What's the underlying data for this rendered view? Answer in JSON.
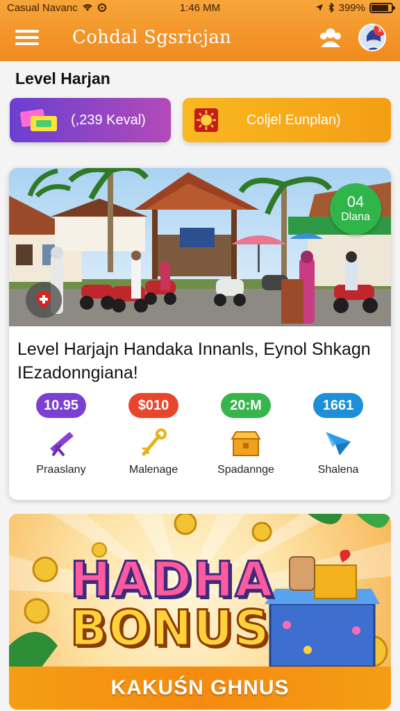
{
  "status_bar": {
    "carrier": "Casual Navanc",
    "time": "1:46 MM",
    "battery": "399%"
  },
  "header": {
    "title": "Cohdal Sgsricjan",
    "menu_icon": "hamburger-menu-icon",
    "group_icon": "users-icon",
    "notification_badge": "x"
  },
  "section": {
    "title": "Level Harjan"
  },
  "action_buttons": {
    "left": {
      "label": "(,239 Keval)",
      "icon": "tickets-icon",
      "color": "#7b3fd1"
    },
    "right": {
      "label": "Coljel Eunplan)",
      "icon": "sun-badge-icon",
      "color": "#f6a81a"
    }
  },
  "feature_card": {
    "badge_number": "04",
    "badge_text": "Dlana",
    "headline": "Level Harjajn Handaka Innanls, Eynol Shkagn IEzadonngiana!",
    "stats": [
      {
        "value": "10.95",
        "label": "Praaslany",
        "icon": "telescope-icon",
        "color": "#7b3fd1"
      },
      {
        "value": "$010",
        "label": "Malenage",
        "icon": "wrench-icon",
        "color": "#e8452c"
      },
      {
        "value": "20:M",
        "label": "Spadannge",
        "icon": "box-icon",
        "color": "#36b54a"
      },
      {
        "value": "1661",
        "label": "Shalena",
        "icon": "paper-plane-icon",
        "color": "#1c8fd8"
      }
    ]
  },
  "promo_banner": {
    "line1": "HADHA",
    "line2": "BONUS",
    "caption": "KAKUŚN GHNUS",
    "icons": [
      "coin-icon",
      "gift-box-icon",
      "palm-leaf-icon"
    ]
  }
}
